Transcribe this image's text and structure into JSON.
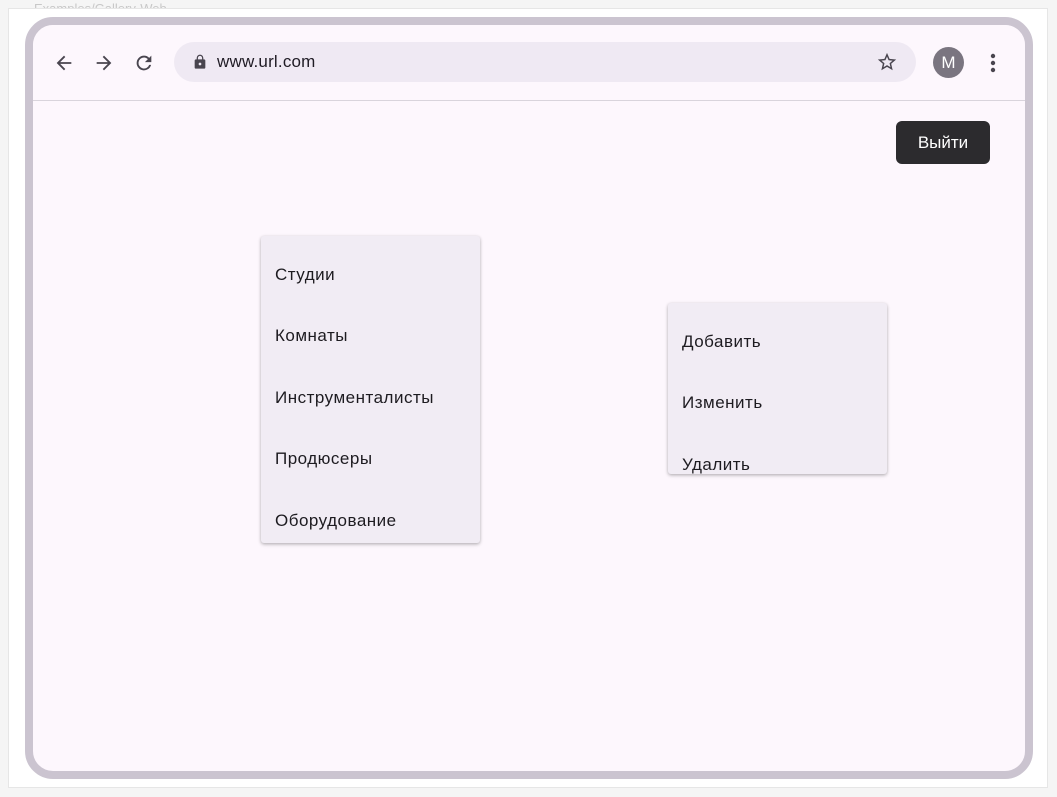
{
  "canvas": {
    "label": "Examples/Gallery-Web"
  },
  "browser": {
    "url": "www.url.com",
    "avatar_letter": "M",
    "icons": {
      "back": "arrow-back-icon",
      "forward": "arrow-forward-icon",
      "reload": "reload-icon",
      "lock": "lock-icon",
      "bookmark": "star-icon",
      "menu": "more-vert-icon"
    }
  },
  "page": {
    "logout_label": "Выйти",
    "nav_menu": {
      "items": [
        {
          "label": "Студии"
        },
        {
          "label": "Комнаты"
        },
        {
          "label": "Инструменталисты"
        },
        {
          "label": "Продюсеры"
        },
        {
          "label": "Оборудование"
        }
      ]
    },
    "action_menu": {
      "items": [
        {
          "label": "Добавить"
        },
        {
          "label": "Изменить"
        },
        {
          "label": "Удалить"
        }
      ]
    }
  },
  "colors": {
    "page_background": "#fdf7fd",
    "frame_border": "#cbc4d0",
    "urlbar_background": "#efe9f3",
    "menu_background": "#f1ecf4",
    "button_background": "#2c2b2e"
  }
}
